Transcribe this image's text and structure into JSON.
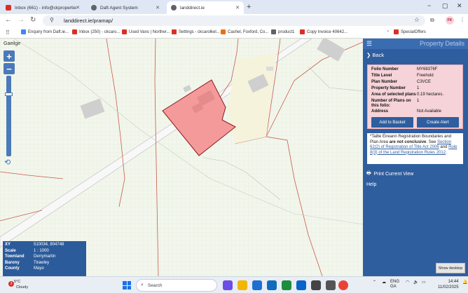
{
  "browser": {
    "tabs": [
      {
        "title": "Inbox (661) - info@ckpropertie",
        "icon": "gmail-icon",
        "color": "#d93025"
      },
      {
        "title": "Daft Agent System",
        "icon": "globe-icon",
        "color": "#5f6368"
      },
      {
        "title": "landdirect.ie",
        "icon": "globe-icon",
        "color": "#5f6368"
      }
    ],
    "url": "landdirect.ie/pramap/",
    "bookmarks": [
      {
        "label": "Enquiry from Daft.ie...",
        "color": "#4285f4"
      },
      {
        "label": "Inbox (250) - ckcaro...",
        "color": "#d93025"
      },
      {
        "label": "Used Vans | Norther...",
        "color": "#d93025"
      },
      {
        "label": "Settings - ckcarolkel...",
        "color": "#d93025"
      },
      {
        "label": "Cashel, Foxford, Co...",
        "color": "#e8710a"
      },
      {
        "label": "product1",
        "color": "#5f6368"
      },
      {
        "label": "Copy Invoice 40642...",
        "color": "#d93025"
      },
      {
        "label": "SpecialOffers",
        "color": "#d93025"
      }
    ],
    "profile_initials": "FK"
  },
  "map": {
    "language_link": "Gaeilge",
    "zoom_in": "+",
    "zoom_out": "−",
    "info": [
      {
        "k": "XY",
        "v": "510034, 804748"
      },
      {
        "k": "Scale",
        "v": "1 : 1000"
      },
      {
        "k": "Townland",
        "v": "Derrymartin"
      },
      {
        "k": "Barony",
        "v": "Tirawley"
      },
      {
        "k": "County",
        "v": "Mayo"
      }
    ],
    "colors": {
      "parcel_fill": "#f59a9a",
      "parcel_stroke": "#8b1a1a",
      "boundary": "#c0392b",
      "road": "#d8d8d8"
    }
  },
  "sidebar": {
    "title": "Property Details",
    "back": "Back",
    "details": [
      {
        "k": "Folio Number",
        "v": "MY68376F"
      },
      {
        "k": "Title Level",
        "v": "Freehold"
      },
      {
        "k": "Plan Number",
        "v": "C3VCE"
      },
      {
        "k": "Property Number",
        "v": "1"
      },
      {
        "k": "Area of selected plans",
        "v": "0.19 hectares."
      },
      {
        "k": "Number of Plans on this folio:",
        "v": "1"
      },
      {
        "k": "Address",
        "v": "Not Available"
      }
    ],
    "add_to_basket": "Add to Basket",
    "create_alert": "Create Alert",
    "notice": {
      "p1": "*Tailte Éireann Registration Boundaries and Plan Area",
      "p2": "are not conclusive",
      "p3": ". See",
      "link1": "Section 62(2) of Registration of Title Act 2006",
      "p4": "and",
      "link2": "Rule 8(3) of the Land Registration Rules 2012",
      "p5": "."
    },
    "print": "Print Current View",
    "help": "Help",
    "show_desktop": "Show desktop"
  },
  "taskbar": {
    "weather_badge": "3",
    "temp": "5°C",
    "condition": "Cloudy",
    "search_placeholder": "Search",
    "lang1": "ENG",
    "lang2": "GA",
    "time": "14:44",
    "date": "11/02/2025"
  }
}
